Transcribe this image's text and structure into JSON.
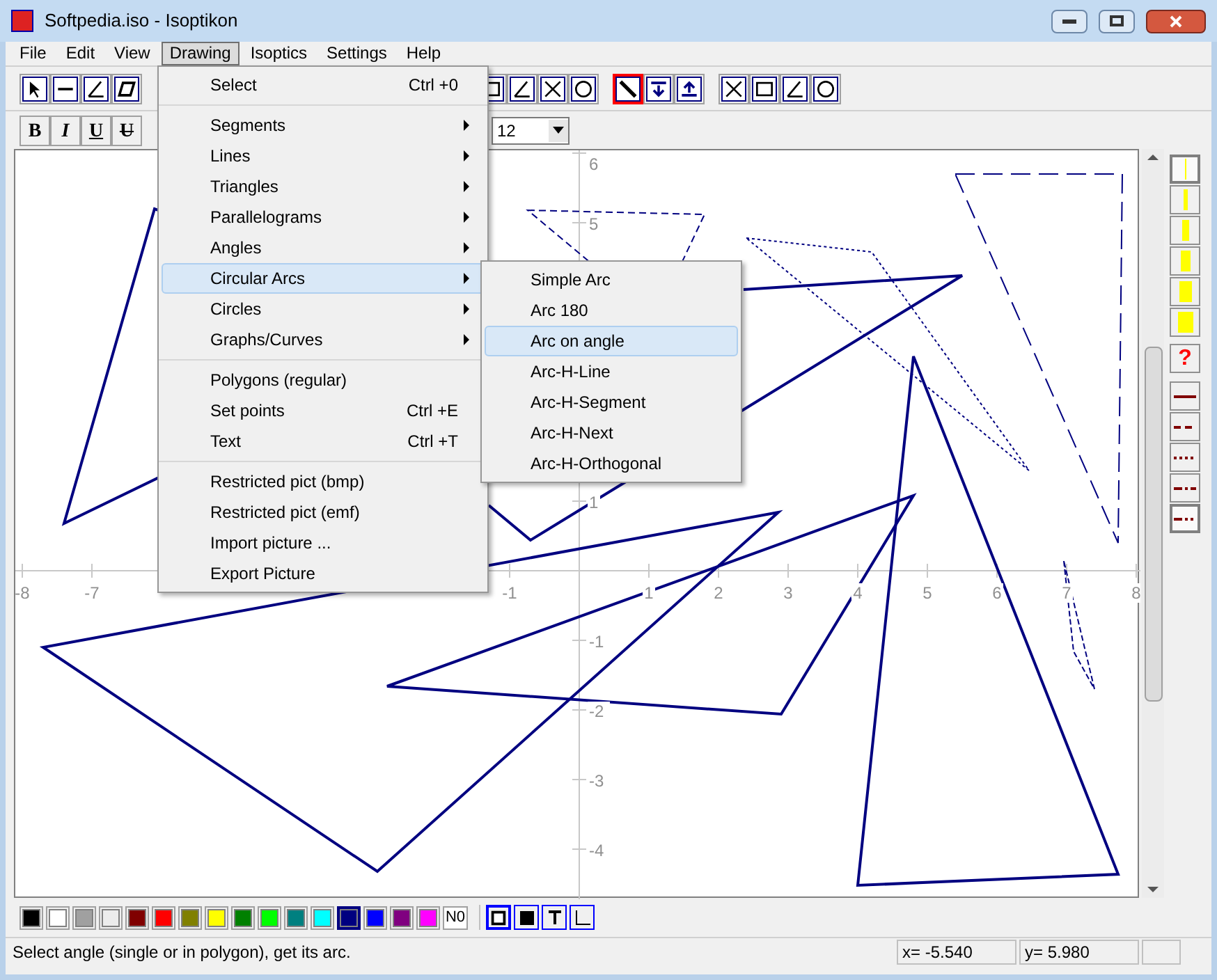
{
  "window": {
    "title": "Softpedia.iso - Isoptikon"
  },
  "menu": [
    {
      "label": "File",
      "selected": false
    },
    {
      "label": "Edit",
      "selected": false
    },
    {
      "label": "View",
      "selected": false
    },
    {
      "label": "Drawing",
      "selected": true
    },
    {
      "label": "Isoptics",
      "selected": false
    },
    {
      "label": "Settings",
      "selected": false
    },
    {
      "label": "Help",
      "selected": false
    }
  ],
  "drawing_menu": [
    [
      {
        "label": "Select",
        "shortcut": "Ctrl +0",
        "submenu": false,
        "selected": false
      }
    ],
    [
      {
        "label": "Segments",
        "submenu": true,
        "selected": false
      },
      {
        "label": "Lines",
        "submenu": true,
        "selected": false
      },
      {
        "label": "Triangles",
        "submenu": true,
        "selected": false
      },
      {
        "label": "Parallelograms",
        "submenu": true,
        "selected": false
      },
      {
        "label": "Angles",
        "submenu": true,
        "selected": false
      },
      {
        "label": "Circular Arcs",
        "submenu": true,
        "selected": true
      },
      {
        "label": "Circles",
        "submenu": true,
        "selected": false
      },
      {
        "label": "Graphs/Curves",
        "submenu": true,
        "selected": false
      }
    ],
    [
      {
        "label": "Polygons (regular)",
        "submenu": false,
        "selected": false
      },
      {
        "label": "Set points",
        "shortcut": "Ctrl +E",
        "submenu": false,
        "selected": false
      },
      {
        "label": "Text",
        "shortcut": "Ctrl +T",
        "submenu": false,
        "selected": false
      }
    ],
    [
      {
        "label": "Restricted pict (bmp)",
        "submenu": false,
        "selected": false
      },
      {
        "label": "Restricted pict (emf)",
        "submenu": false,
        "selected": false
      },
      {
        "label": "Import picture ...",
        "submenu": false,
        "selected": false
      },
      {
        "label": "Export Picture",
        "submenu": false,
        "selected": false
      }
    ]
  ],
  "arcs_submenu": [
    {
      "label": "Simple Arc",
      "selected": false
    },
    {
      "label": "Arc 180",
      "selected": false
    },
    {
      "label": "Arc on angle",
      "selected": true
    },
    {
      "label": "Arc-H-Line",
      "selected": false
    },
    {
      "label": "Arc-H-Segment",
      "selected": false
    },
    {
      "label": "Arc-H-Next",
      "selected": false
    },
    {
      "label": "Arc-H-Orthogonal",
      "selected": false
    }
  ],
  "format_buttons": [
    {
      "label": "B",
      "kind": "bold"
    },
    {
      "label": "I",
      "kind": "italic"
    },
    {
      "label": "U",
      "kind": "underline"
    },
    {
      "label": "U",
      "kind": "strike"
    }
  ],
  "font_size": {
    "value": "12"
  },
  "axes": {
    "x_labels": [
      "-8",
      "-7",
      "-1",
      "1",
      "2",
      "3",
      "4",
      "5",
      "6",
      "7",
      "8"
    ],
    "y_labels": [
      "6",
      "5",
      "1",
      "-1",
      "-2",
      "-3",
      "-4"
    ]
  },
  "thickness_buttons": [
    {
      "selected": true
    },
    {
      "selected": false
    },
    {
      "selected": false
    },
    {
      "selected": false
    },
    {
      "selected": false
    },
    {
      "selected": false
    }
  ],
  "help_button": {
    "label": "?"
  },
  "style_buttons": [
    {
      "kind": "solid",
      "selected": false
    },
    {
      "kind": "dash",
      "selected": false
    },
    {
      "kind": "dot",
      "selected": false
    },
    {
      "kind": "dashdot",
      "selected": false
    },
    {
      "kind": "dashdotdot",
      "selected": true
    }
  ],
  "palette": [
    {
      "color": "#000000",
      "selected": false
    },
    {
      "color": "#ffffff",
      "selected": false
    },
    {
      "color": "#a0a0a0",
      "selected": false
    },
    {
      "color": "#ececec",
      "selected": false
    },
    {
      "color": "#800000",
      "selected": false
    },
    {
      "color": "#ff0000",
      "selected": false
    },
    {
      "color": "#808000",
      "selected": false
    },
    {
      "color": "#ffff00",
      "selected": false
    },
    {
      "color": "#008000",
      "selected": false
    },
    {
      "color": "#00ff00",
      "selected": false
    },
    {
      "color": "#008080",
      "selected": false
    },
    {
      "color": "#00ffff",
      "selected": false
    },
    {
      "color": "#000080",
      "selected": true
    },
    {
      "color": "#0000ff",
      "selected": false
    },
    {
      "color": "#800080",
      "selected": false
    },
    {
      "color": "#ff00ff",
      "selected": false
    }
  ],
  "no_color_button": {
    "label": "N0"
  },
  "fill_buttons": [
    {
      "kind": "frame",
      "selected": true
    },
    {
      "kind": "filled",
      "selected": false
    },
    {
      "kind": "text",
      "selected": false
    },
    {
      "kind": "corner",
      "selected": false
    }
  ],
  "status_bar": {
    "message": "Select angle (single or in polygon), get its arc.",
    "x": "x= -5.540",
    "y": "y= 5.980"
  }
}
